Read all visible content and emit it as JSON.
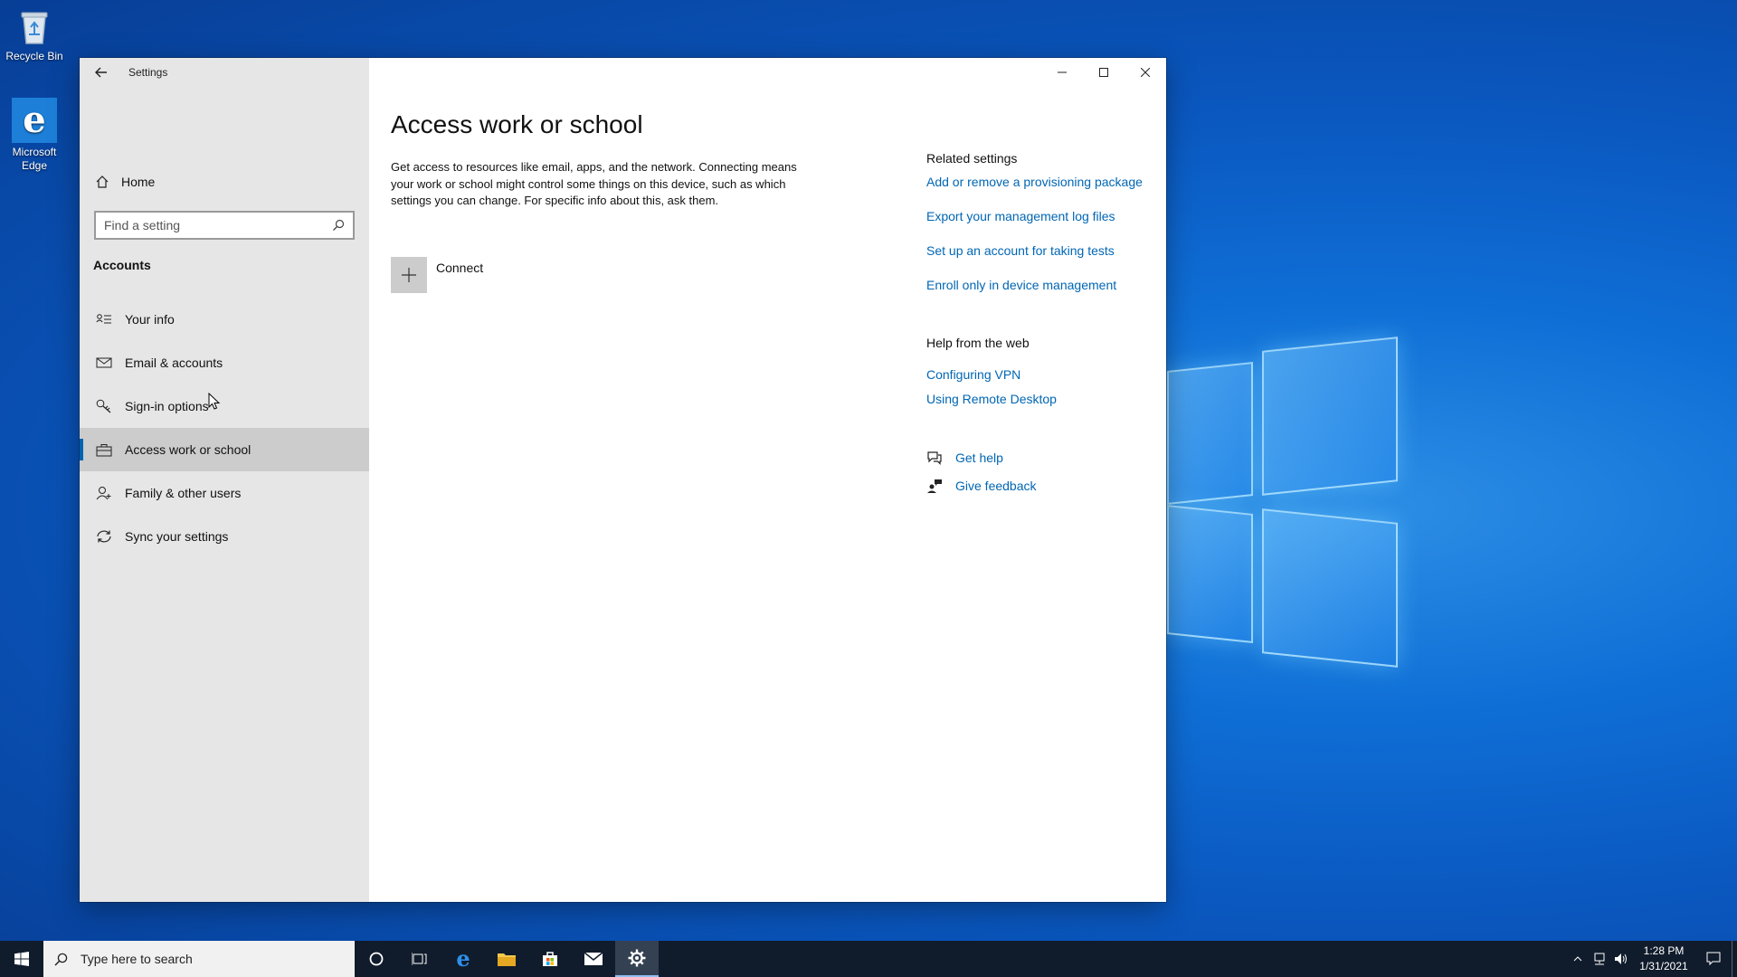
{
  "desktop": {
    "icons": [
      {
        "label": "Recycle Bin"
      },
      {
        "label": "Microsoft Edge"
      }
    ]
  },
  "window": {
    "title": "Settings",
    "sidebar": {
      "home_label": "Home",
      "search_placeholder": "Find a setting",
      "section_heading": "Accounts",
      "items": [
        {
          "label": "Your info",
          "icon": "contact-card-icon"
        },
        {
          "label": "Email & accounts",
          "icon": "mail-icon"
        },
        {
          "label": "Sign-in options",
          "icon": "key-icon"
        },
        {
          "label": "Access work or school",
          "icon": "briefcase-icon",
          "selected": true
        },
        {
          "label": "Family & other users",
          "icon": "person-add-icon"
        },
        {
          "label": "Sync your settings",
          "icon": "sync-icon"
        }
      ]
    },
    "main": {
      "page_title": "Access work or school",
      "description": "Get access to resources like email, apps, and the network. Connecting means your work or school might control some things on this device, such as which settings you can change. For specific info about this, ask them.",
      "connect_label": "Connect",
      "related_settings": {
        "heading": "Related settings",
        "links": [
          "Add or remove a provisioning package",
          "Export your management log files",
          "Set up an account for taking tests",
          "Enroll only in device management"
        ]
      },
      "help_from_web": {
        "heading": "Help from the web",
        "links": [
          "Configuring VPN",
          "Using Remote Desktop"
        ]
      },
      "get_help": "Get help",
      "give_feedback": "Give feedback"
    }
  },
  "taskbar": {
    "search_placeholder": "Type here to search",
    "time": "1:28 PM",
    "date": "1/31/2021"
  },
  "colors": {
    "accent": "#0063b1",
    "link": "#0066b4",
    "sidebar_bg": "#e6e6e6",
    "taskbar_bg": "#101c2c"
  }
}
